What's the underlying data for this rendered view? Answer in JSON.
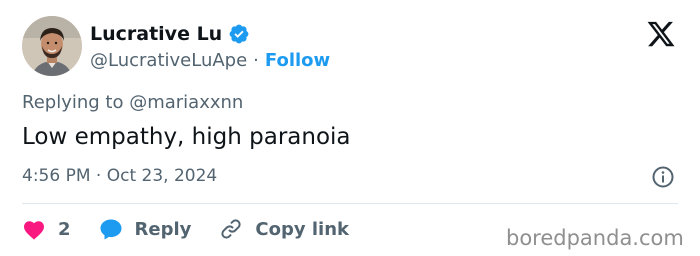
{
  "author": {
    "display_name": "Lucrative Lu",
    "handle": "@LucrativeLuApe",
    "separator": "·",
    "follow_label": "Follow",
    "verified": true
  },
  "brand_icon": "x-logo-icon",
  "reply": {
    "prefix": "Replying to ",
    "mention": "@mariaxxnn"
  },
  "tweet": {
    "text": "Low empathy, high paranoia",
    "time": "4:56 PM",
    "separator": "·",
    "date": "Oct 23, 2024"
  },
  "actions": {
    "like_count": "2",
    "reply_label": "Reply",
    "copy_link_label": "Copy link"
  },
  "watermark": "boredpanda.com",
  "colors": {
    "accent": "#1d9bf0",
    "like": "#f91880",
    "secondary_text": "#536471",
    "primary_text": "#0f1419"
  }
}
